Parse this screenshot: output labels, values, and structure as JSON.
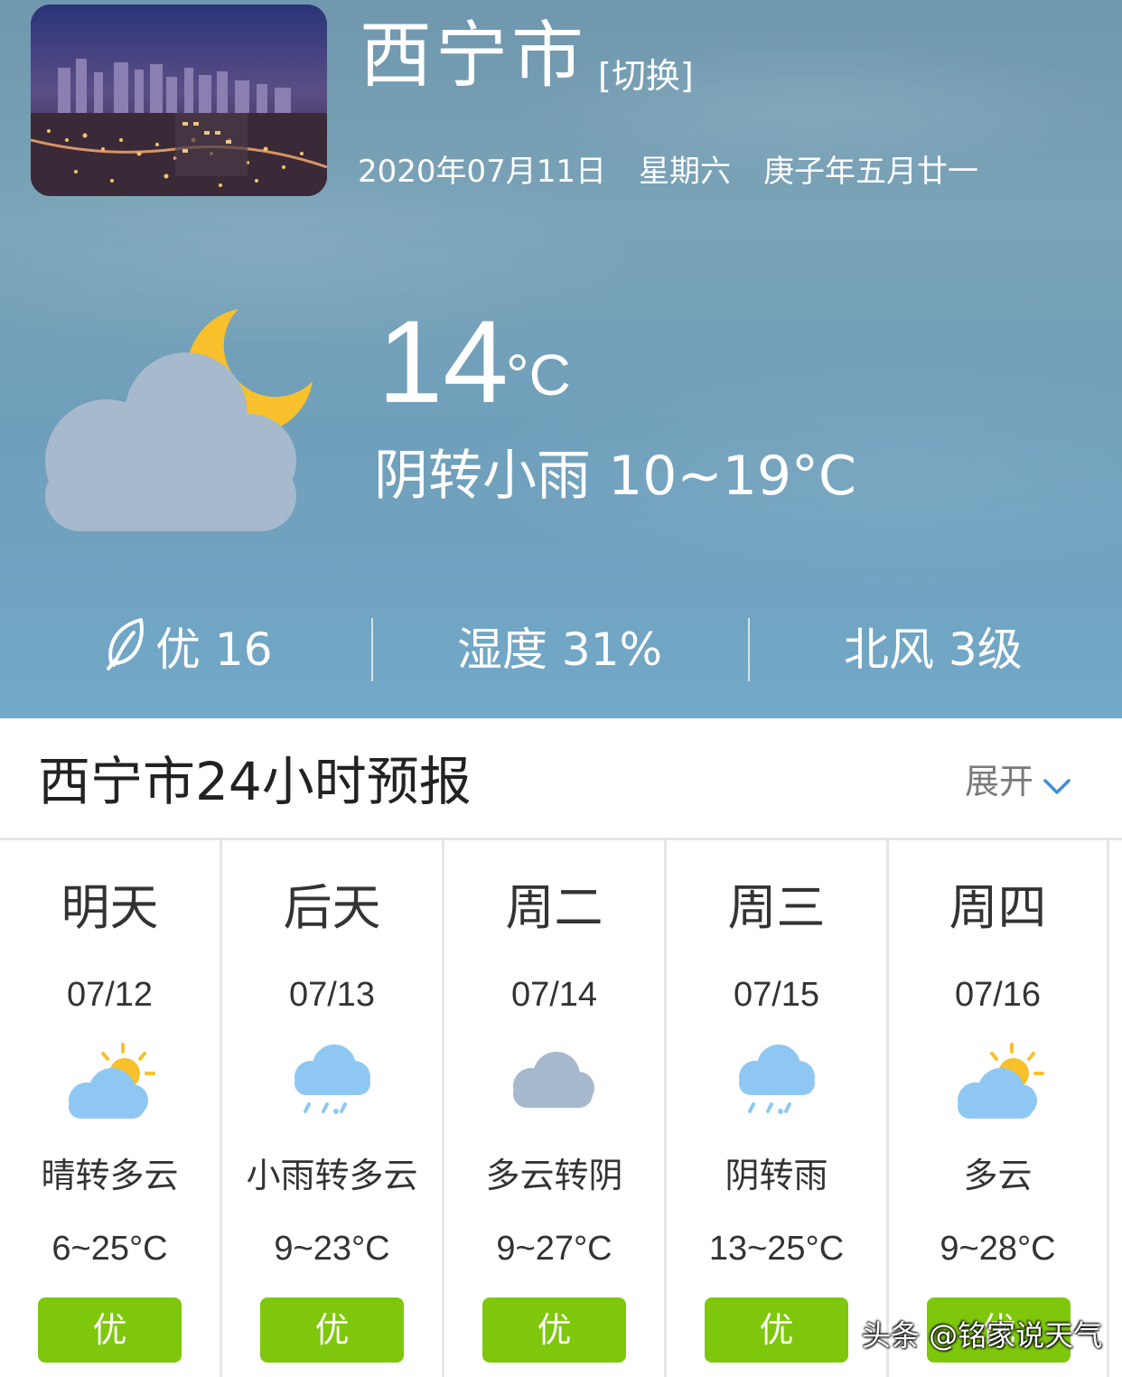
{
  "header": {
    "city": "西宁市",
    "switch_label": "[切换]",
    "date": "2020年07月11日",
    "weekday": "星期六",
    "lunar_date": "庚子年五月廿一"
  },
  "current": {
    "temperature": "14",
    "unit": "°C",
    "condition_range": "阴转小雨 10~19°C",
    "icon": "cloud-moon-icon"
  },
  "stats": {
    "aqi": "优 16",
    "humidity": "湿度 31%",
    "wind": "北风 3级"
  },
  "section": {
    "title": "西宁市24小时预报",
    "expand_label": "展开"
  },
  "days": [
    {
      "name": "明天",
      "date": "07/12",
      "condition": "晴转多云",
      "temp": "6~25°C",
      "aqi": "优",
      "icon": "partly-sunny-icon"
    },
    {
      "name": "后天",
      "date": "07/13",
      "condition": "小雨转多云",
      "temp": "9~23°C",
      "aqi": "优",
      "icon": "light-rain-icon"
    },
    {
      "name": "周二",
      "date": "07/14",
      "condition": "多云转阴",
      "temp": "9~27°C",
      "aqi": "优",
      "icon": "overcast-icon"
    },
    {
      "name": "周三",
      "date": "07/15",
      "condition": "阴转雨",
      "temp": "13~25°C",
      "aqi": "优",
      "icon": "rain-icon"
    },
    {
      "name": "周四",
      "date": "07/16",
      "condition": "多云",
      "temp": "9~28°C",
      "aqi": "优",
      "icon": "partly-sunny-icon"
    }
  ],
  "colors": {
    "aqi_good": "#7ec70d",
    "sky": "#72a8c8"
  },
  "watermark": "头条 @铭家说天气"
}
